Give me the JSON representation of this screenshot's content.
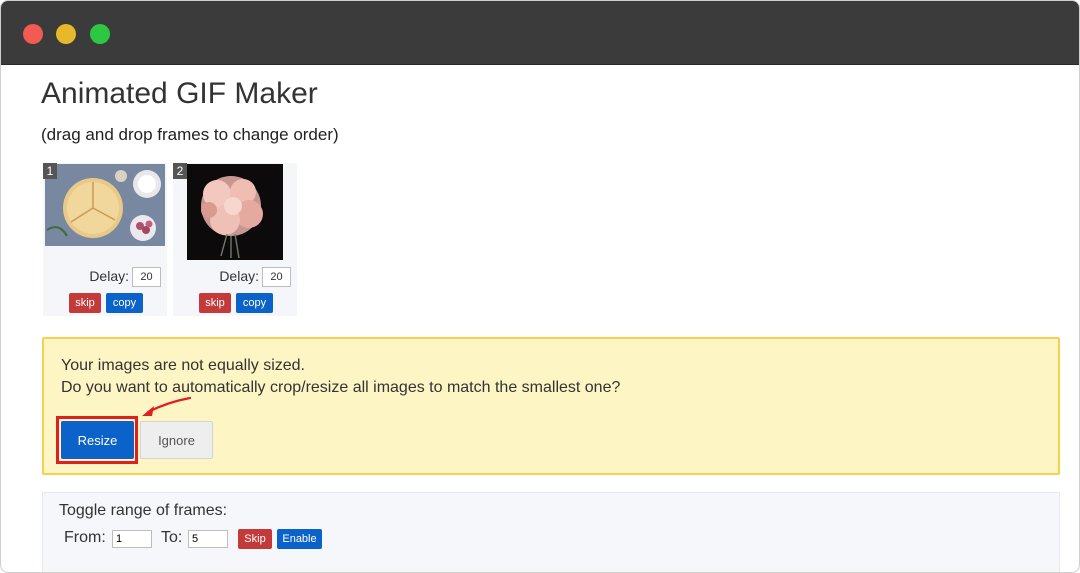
{
  "app": {
    "title": "Animated GIF Maker",
    "subtitle": "(drag and drop frames to change order)"
  },
  "frames": [
    {
      "number": "1",
      "delay_label": "Delay:",
      "delay_value": "20",
      "skip_label": "skip",
      "copy_label": "copy",
      "thumb_icon": "pancake-photo"
    },
    {
      "number": "2",
      "delay_label": "Delay:",
      "delay_value": "20",
      "skip_label": "skip",
      "copy_label": "copy",
      "thumb_icon": "pink-flower-photo"
    }
  ],
  "alert": {
    "line1": "Your images are not equally sized.",
    "line2": "Do you want to automatically crop/resize all images to match the smallest one?",
    "resize_label": "Resize",
    "ignore_label": "Ignore"
  },
  "range": {
    "title": "Toggle range of frames:",
    "from_label": "From:",
    "from_value": "1",
    "to_label": "To:",
    "to_value": "5",
    "skip_label": "Skip",
    "enable_label": "Enable"
  },
  "colors": {
    "primary": "#0b63c9",
    "danger": "#c43a3a",
    "warning_bg": "#fdf5c4",
    "warning_border": "#f4d24e",
    "annotation": "#e02020"
  }
}
